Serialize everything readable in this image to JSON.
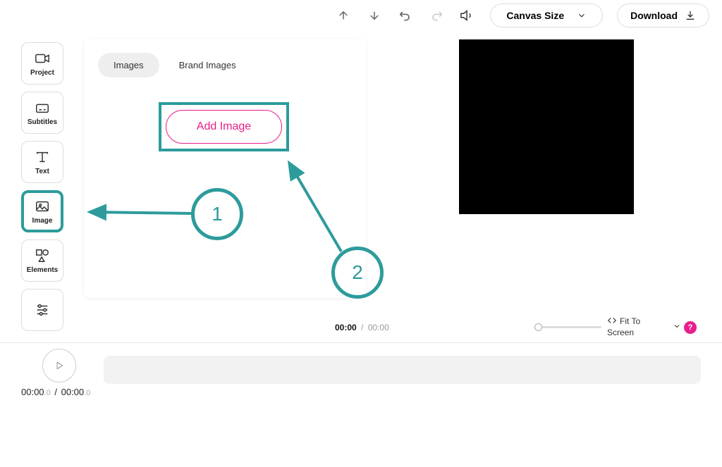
{
  "toolbar": {
    "canvas_size_label": "Canvas Size",
    "download_label": "Download"
  },
  "sidebar": {
    "items": [
      {
        "label": "Project"
      },
      {
        "label": "Subtitles"
      },
      {
        "label": "Text"
      },
      {
        "label": "Image"
      },
      {
        "label": "Elements"
      }
    ]
  },
  "panel": {
    "tabs": [
      {
        "label": "Images"
      },
      {
        "label": "Brand Images"
      }
    ],
    "add_image_label": "Add Image"
  },
  "annotations": {
    "step1": "1",
    "step2": "2"
  },
  "timebar": {
    "current": "00:00",
    "separator": "/",
    "total": "00:00",
    "fit_label": "Fit To Screen",
    "help": "?"
  },
  "transport": {
    "current": "00:00",
    "current_decimal": ".0",
    "separator": "/",
    "total": "00:00",
    "total_decimal": ".0"
  },
  "colors": {
    "accent_teal": "#2d9b9b",
    "accent_pink": "#e91e8c"
  }
}
